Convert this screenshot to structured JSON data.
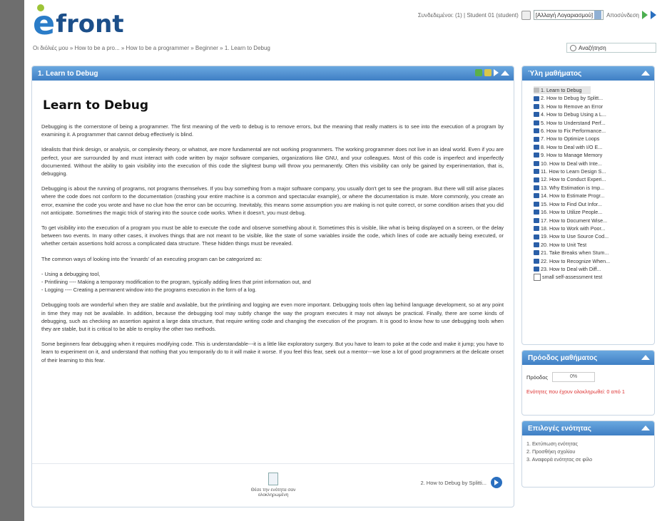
{
  "header": {
    "logo_text": "front",
    "user_label": "Συνδεδεμένοι: (1) | Student 01 (student)",
    "language": "[Αλλαγή Λογαριασμού]",
    "logout": "Αποσύνδεση"
  },
  "breadcrumb": "Οι διόλιές μου » How to be a pro... » How to be a programmer » Beginner » 1. Learn to Debug",
  "search": {
    "placeholder": "Αναζήτηση"
  },
  "main": {
    "bar_title": "1. Learn to Debug",
    "heading": "Learn to Debug",
    "paragraphs": [
      "Debugging is the cornerstone of being a programmer. The first meaning of the verb to debug is to remove errors, but the meaning that really matters is to see into the execution of a program by examining it. A programmer that cannot debug effectively is blind.",
      "Idealists that think design, or analysis, or complexity theory, or whatnot, are more fundamental are not working programmers. The working programmer does not live in an ideal world. Even if you are perfect, your are surrounded by and must interact with code written by major software companies, organizations like GNU, and your colleagues. Most of this code is imperfect and imperfectly documented. Without the ability to gain visibility into the execution of this code the slightest bump will throw you permanently. Often this visibility can only be gained by experimentation, that is, debugging.",
      "Debugging is about the running of programs, not programs themselves. If you buy something from a major software company, you usually don't get to see the program. But there will still arise places where the code does not conform to the documentation (crashing your entire machine is a common and spectacular example), or where the documentation is mute. More commonly, you create an error, examine the code you wrote and have no clue how the error can be occurring. Inevitably, this means some assumption you are making is not quite correct, or some condition arises that you did not anticipate. Sometimes the magic trick of staring into the source code works. When it doesn't, you must debug.",
      "To get visibility into the execution of a program you must be able to execute the code and observe something about it. Sometimes this is visible, like what is being displayed on a screen, or the delay between two events. In many other cases, it involves things that are not meant to be visible, like the state of some variables inside the code, which lines of code are actually being executed, or whether certain assertions hold across a complicated data structure. These hidden things must be revealed.",
      "The common ways of looking into the 'innards' of an executing program can be categorized as:"
    ],
    "list": [
      "- Using a debugging tool,",
      "- Printlining ---- Making a temporary modification to the program, typically adding lines that print information out, and",
      "- Logging ---- Creating a permanent window into the programs execution in the form of a log."
    ],
    "paragraphs2": [
      "Debugging tools are wonderful when they are stable and available, but the printlining and logging are even more important. Debugging tools often lag behind language development, so at any point in time they may not be available. In addition, because the debugging tool may subtly change the way the program executes it may not always be practical. Finally, there are some kinds of debugging, such as checking an assertion against a large data structure, that require writing code and changing the execution of the program. It is good to know how to use debugging tools when they are stable, but it is critical to be able to employ the other two methods.",
      "Some beginners fear debugging when it requires modifying code. This is understandable---it is a little like exploratory surgery. But you have to learn to poke at the code and make it jump; you have to learn to experiment on it, and understand that nothing that you temporarily do to it will make it worse. If you feel this fear, seek out a mentor---we lose a lot of good programmers at the delicate onset of their learning to this fear."
    ],
    "finish_label": "Θέσε την ενότητα σαν ολοκληρωμένη",
    "next_label": "2. How to Debug by Splitti..."
  },
  "units_panel": {
    "title": "Ύλη μαθήματος",
    "items": [
      "1. Learn to Debug",
      "2. How to Debug by Splitt...",
      "3. How to Remove an Error",
      "4. How to Debug Using a L...",
      "5. How to Understand Perf...",
      "6. How to Fix Performance...",
      "7. How to Optimize Loops",
      "8. How to Deal with I/O E...",
      "9. How to Manage Memory",
      "10. How to Deal with Inte...",
      "11. How to Learn Design S...",
      "12. How to Conduct Experi...",
      "13. Why Estimation is Imp...",
      "14. How to Estimate Progr...",
      "15. How to Find Out Infor...",
      "16. How to Utilize People...",
      "17. How to Document Wise...",
      "18. How to Work with Poor...",
      "19. How to Use Source Cod...",
      "20. How to Unit Test",
      "21. Take Breaks when Stum...",
      "22. How to Recognize When...",
      "23. How to Deal with Diff..."
    ],
    "self_test": "small self-assessment test"
  },
  "progress_panel": {
    "title": "Πρόοδος μαθήματος",
    "label": "Πρόοδος",
    "value_text": "0%",
    "value": 0,
    "note": "Ενότητες που έχουν ολοκληρωθεί: 0 από 1"
  },
  "options_panel": {
    "title": "Επιλογές ενότητας",
    "items": [
      "1. Εκτύπωση ενότητας",
      "2. Προσθήκη σχολίου",
      "3. Αναφορά ενότητας σε φίλο"
    ]
  },
  "colors": {
    "bar": "#3f7fc4",
    "accent": "#2a6fbf",
    "green": "#9dc437",
    "warning": "#d33333"
  }
}
